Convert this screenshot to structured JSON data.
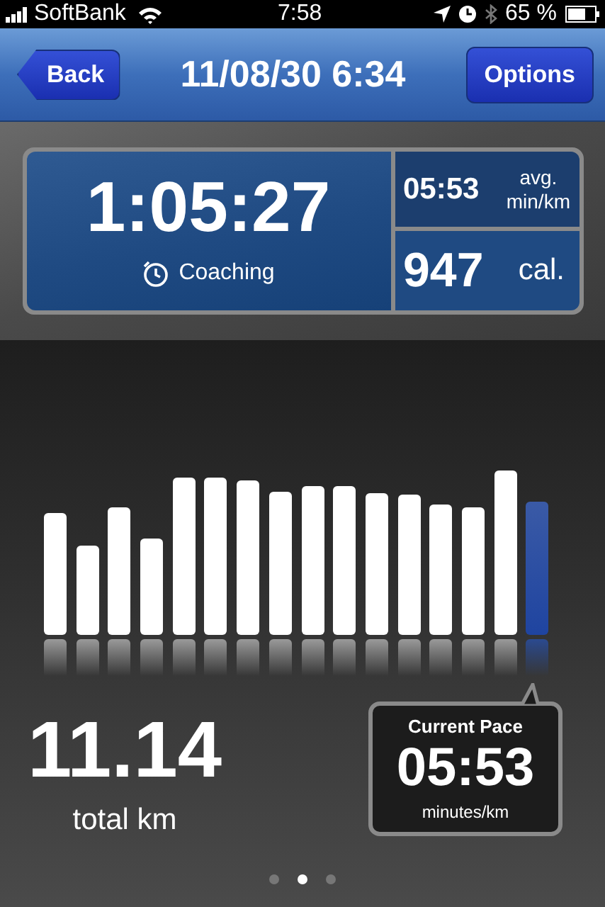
{
  "status_bar": {
    "carrier": "SoftBank",
    "time": "7:58",
    "battery": "65 %"
  },
  "nav": {
    "back": "Back",
    "title": "11/08/30 6:34",
    "options": "Options"
  },
  "summary": {
    "duration": "1:05:27",
    "coaching": "Coaching",
    "avg_pace": "05:53",
    "avg_unit_1": "avg.",
    "avg_unit_2": "min/km",
    "calories": "947",
    "calories_unit": "cal."
  },
  "splits": [
    {
      "selected": false
    },
    {
      "selected": false
    },
    {
      "selected": false
    },
    {
      "selected": false
    },
    {
      "selected": false
    },
    {
      "selected": false
    },
    {
      "selected": false
    },
    {
      "selected": false
    },
    {
      "selected": false
    },
    {
      "selected": false
    },
    {
      "selected": false
    },
    {
      "selected": false
    },
    {
      "selected": false
    },
    {
      "selected": false
    },
    {
      "selected": false
    },
    {
      "selected": true
    }
  ],
  "distance": {
    "value": "11.14",
    "unit": "total km"
  },
  "callout": {
    "title": "Current Pace",
    "value": "05:53",
    "unit": "minutes/km"
  },
  "pages": [
    {
      "selected": false
    },
    {
      "selected": true
    },
    {
      "selected": false
    }
  ]
}
